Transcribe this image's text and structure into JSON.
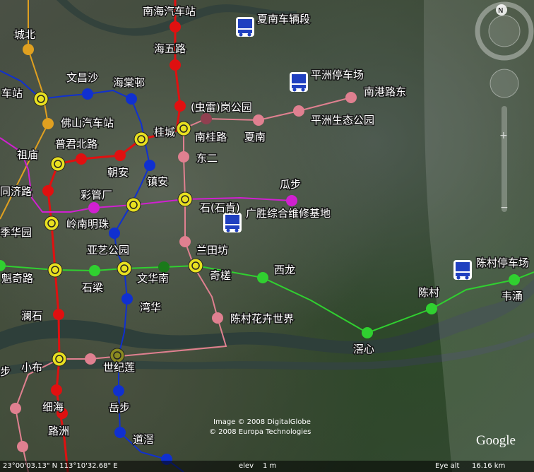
{
  "stations": [
    {
      "name": "南海汽车站"
    },
    {
      "name": "夏南车辆段"
    },
    {
      "name": "城北"
    },
    {
      "name": "海五路"
    },
    {
      "name": "文昌沙"
    },
    {
      "name": "海棠邨"
    },
    {
      "name": "平洲停车场"
    },
    {
      "name": "南港路东"
    },
    {
      "name": "车站"
    },
    {
      "name": "(虫雷)岗公园"
    },
    {
      "name": "平洲生态公园"
    },
    {
      "name": "佛山汽车站"
    },
    {
      "name": "桂城"
    },
    {
      "name": "南桂路"
    },
    {
      "name": "夏南"
    },
    {
      "name": "普君北路"
    },
    {
      "name": "祖庙"
    },
    {
      "name": "东二"
    },
    {
      "name": "朝安"
    },
    {
      "name": "镇安"
    },
    {
      "name": "同济路"
    },
    {
      "name": "彩管厂"
    },
    {
      "name": "瓜步"
    },
    {
      "name": "石(石肯)"
    },
    {
      "name": "广胜综合维修基地"
    },
    {
      "name": "季华园"
    },
    {
      "name": "岭南明珠"
    },
    {
      "name": "亚艺公园"
    },
    {
      "name": "兰田坊"
    },
    {
      "name": "魁奇路"
    },
    {
      "name": "石梁"
    },
    {
      "name": "文华南"
    },
    {
      "name": "奇槎"
    },
    {
      "name": "西龙"
    },
    {
      "name": "陈村停车场"
    },
    {
      "name": "韦涌"
    },
    {
      "name": "澜石"
    },
    {
      "name": "湾华"
    },
    {
      "name": "陈村"
    },
    {
      "name": "陈村花卉世界"
    },
    {
      "name": "滘心"
    },
    {
      "name": "步"
    },
    {
      "name": "小布"
    },
    {
      "name": "世纪莲"
    },
    {
      "name": "细海"
    },
    {
      "name": "岳步"
    },
    {
      "name": "路洲"
    },
    {
      "name": "道滘"
    }
  ],
  "imagery": {
    "credit_line1": "Image © 2008 DigitalGlobe",
    "credit_line2": "© 2008 Europa Technologies"
  },
  "status": {
    "coords": "23°00'03.13\" N   113°10'32.68\" E",
    "elev_label": "elev",
    "elev_value": "1 m",
    "eye_alt_label": "Eye alt",
    "eye_alt_value": "16.16 km"
  },
  "brand": {
    "logo_text": "Google"
  },
  "compass": {
    "north_label": "N"
  },
  "colors": {
    "line1_red": "#e01010",
    "line2_blue": "#1030d0",
    "line3_green": "#30d030",
    "line_pink": "#e08090",
    "line_magenta": "#d020d0",
    "line_orange": "#e0a020",
    "interchange_yellow": "#e8e020",
    "depot_blue": "#2040c0"
  }
}
